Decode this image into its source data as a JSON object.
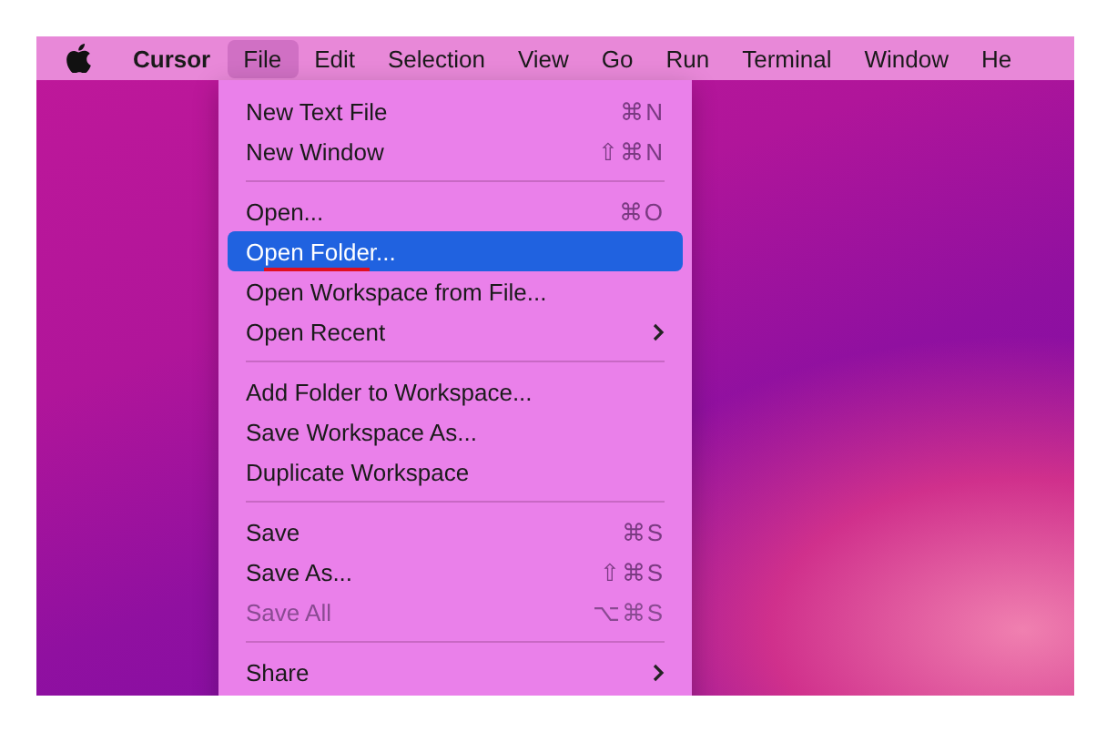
{
  "menu_bar": [
    {
      "kind": "apple"
    },
    {
      "kind": "app",
      "label": "Cursor",
      "selected": false
    },
    {
      "kind": "menu",
      "label": "File",
      "selected": true
    },
    {
      "kind": "menu",
      "label": "Edit",
      "selected": false
    },
    {
      "kind": "menu",
      "label": "Selection",
      "selected": false
    },
    {
      "kind": "menu",
      "label": "View",
      "selected": false
    },
    {
      "kind": "menu",
      "label": "Go",
      "selected": false
    },
    {
      "kind": "menu",
      "label": "Run",
      "selected": false
    },
    {
      "kind": "menu",
      "label": "Terminal",
      "selected": false
    },
    {
      "kind": "menu",
      "label": "Window",
      "selected": false
    },
    {
      "kind": "menu",
      "label": "He",
      "selected": false
    }
  ],
  "file_menu": [
    {
      "kind": "item",
      "label": "New Text File",
      "shortcut": "⌘N",
      "selected": false,
      "disabled": false,
      "submenu": false,
      "underlined": false
    },
    {
      "kind": "item",
      "label": "New Window",
      "shortcut": "⇧⌘N",
      "selected": false,
      "disabled": false,
      "submenu": false,
      "underlined": false
    },
    {
      "kind": "separator"
    },
    {
      "kind": "item",
      "label": "Open...",
      "shortcut": "⌘O",
      "selected": false,
      "disabled": false,
      "submenu": false,
      "underlined": false
    },
    {
      "kind": "item",
      "label": "Open Folder...",
      "selected": true,
      "disabled": false,
      "submenu": false,
      "underlined": true
    },
    {
      "kind": "item",
      "label": "Open Workspace from File...",
      "selected": false,
      "disabled": false,
      "submenu": false,
      "underlined": false
    },
    {
      "kind": "item",
      "label": "Open Recent",
      "selected": false,
      "disabled": false,
      "submenu": true,
      "underlined": false
    },
    {
      "kind": "separator"
    },
    {
      "kind": "item",
      "label": "Add Folder to Workspace...",
      "selected": false,
      "disabled": false,
      "submenu": false,
      "underlined": false
    },
    {
      "kind": "item",
      "label": "Save Workspace As...",
      "selected": false,
      "disabled": false,
      "submenu": false,
      "underlined": false
    },
    {
      "kind": "item",
      "label": "Duplicate Workspace",
      "selected": false,
      "disabled": false,
      "submenu": false,
      "underlined": false
    },
    {
      "kind": "separator"
    },
    {
      "kind": "item",
      "label": "Save",
      "shortcut": "⌘S",
      "selected": false,
      "disabled": false,
      "submenu": false,
      "underlined": false
    },
    {
      "kind": "item",
      "label": "Save As...",
      "shortcut": "⇧⌘S",
      "selected": false,
      "disabled": false,
      "submenu": false,
      "underlined": false
    },
    {
      "kind": "item",
      "label": "Save All",
      "shortcut": "⌥⌘S",
      "selected": false,
      "disabled": true,
      "submenu": false,
      "underlined": false
    },
    {
      "kind": "separator"
    },
    {
      "kind": "item",
      "label": "Share",
      "selected": false,
      "disabled": false,
      "submenu": true,
      "underlined": false
    }
  ]
}
